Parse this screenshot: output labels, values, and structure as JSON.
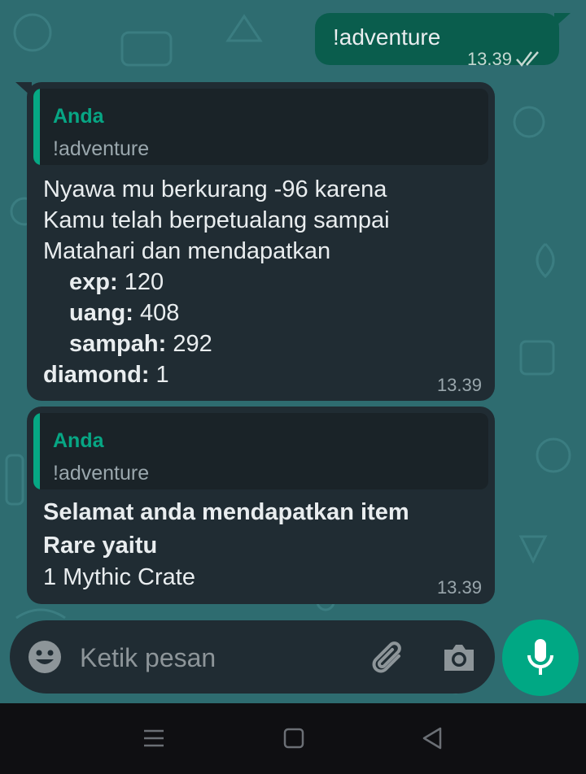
{
  "conversation": {
    "outgoing": {
      "text": "!adventure",
      "time": "13.39"
    },
    "incoming": [
      {
        "quote": {
          "author": "Anda",
          "text": "!adventure"
        },
        "lines": {
          "l1": "Nyawa mu berkurang -96 karena",
          "l2": "Kamu telah berpetualang sampai",
          "l3": "Matahari dan mendapatkan",
          "exp_label": "exp:",
          "exp_value": " 120",
          "uang_label": "uang:",
          "uang_value": " 408",
          "sampah_label": "sampah:",
          "sampah_value": " 292",
          "diamond_label": "diamond:",
          "diamond_value": " 1"
        },
        "time": "13.39"
      },
      {
        "quote": {
          "author": "Anda",
          "text": "!adventure"
        },
        "lines": {
          "l1": "Selamat anda mendapatkan item",
          "l2": "Rare yaitu",
          "l3": "1 Mythic Crate"
        },
        "time": "13.39"
      }
    ]
  },
  "composer": {
    "placeholder": "Ketik pesan",
    "icons": [
      "emoji-icon",
      "attach-icon",
      "camera-icon",
      "mic-icon"
    ]
  },
  "navigation": {
    "icons": [
      "menu-icon",
      "home-icon",
      "back-icon"
    ]
  },
  "colors": {
    "wallpaper": "#2e6c70",
    "outgoing_bubble": "#0a5d4d",
    "incoming_bubble": "#202c33",
    "accent": "#00a884",
    "quote_author": "#07a684"
  }
}
